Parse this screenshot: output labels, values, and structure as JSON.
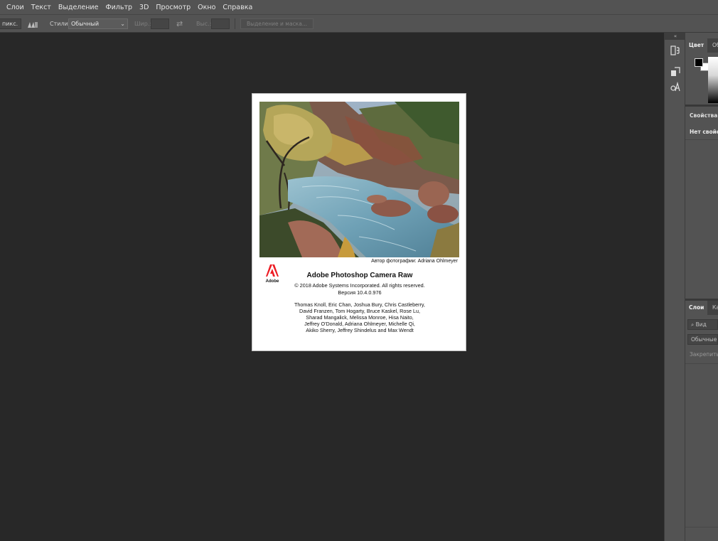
{
  "menu": [
    "Слои",
    "Текст",
    "Выделение",
    "Фильтр",
    "3D",
    "Просмотр",
    "Окно",
    "Справка"
  ],
  "options": {
    "feather_value": "пикс.",
    "style_label": "Стили",
    "style_value": "Обычный",
    "width_label": "Шир.:",
    "height_label": "Выс.:",
    "select_mask_label": "Выделение и маска..."
  },
  "about": {
    "photo_credit": "Автор фотографии: Adriana Ohlmeyer",
    "logo_text": "Adobe",
    "title": "Adobe Photoshop Camera Raw",
    "copyright": "© 2018 Adobe Systems Incorporated. All rights reserved.",
    "version": "Версия 10.4.0.976",
    "credits": [
      "Thomas Knoll, Eric Chan, Joshua Bury, Chris Castleberry,",
      "David Franzen, Tom Hogarty, Bruce Kaskel, Rose Lu,",
      "Sharad Mangalick, Melissa Monroe, Hisa Naito,",
      "Jeffrey O'Donald, Adriana Ohlmeyer, Michelle Qi,",
      "Akiko Sherry, Jeffrey Shindelus and Max Wendt"
    ]
  },
  "toolstrip": {
    "collapse_label": "«"
  },
  "panels": {
    "color_tab": "Цвет",
    "color_tab2": "Об",
    "properties_title": "Свойства",
    "properties_empty": "Нет свойств",
    "layers_tab": "Слои",
    "layers_tab2": "Ка",
    "layers_search": "Вид",
    "blend_mode": "Обычные",
    "lock_label": "Закрепить:"
  },
  "colors": {
    "menubar_bg": "#535353",
    "canvas_bg": "#282828",
    "dialog_bg": "#ffffff",
    "adobe_red": "#ed1c24"
  }
}
